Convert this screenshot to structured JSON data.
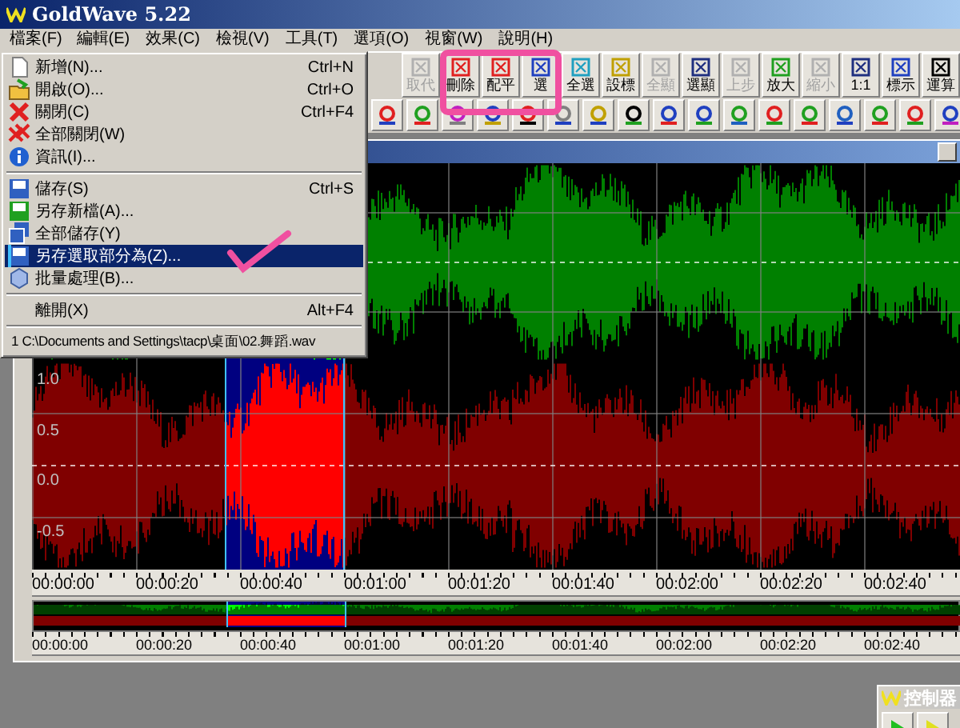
{
  "window": {
    "title": "GoldWave 5.22"
  },
  "menu_bar": [
    {
      "label": "檔案(F)",
      "selected": true
    },
    {
      "label": "編輯(E)",
      "selected": false
    },
    {
      "label": "效果(C)",
      "selected": false
    },
    {
      "label": "檢視(V)",
      "selected": false
    },
    {
      "label": "工具(T)",
      "selected": false
    },
    {
      "label": "選項(O)",
      "selected": false
    },
    {
      "label": "視窗(W)",
      "selected": false
    },
    {
      "label": "說明(H)",
      "selected": false
    }
  ],
  "file_menu": [
    {
      "kind": "command",
      "label": "新增(N)...",
      "shortcut": "Ctrl+N",
      "selected": false
    },
    {
      "kind": "command",
      "label": "開啟(O)...",
      "shortcut": "Ctrl+O",
      "selected": false
    },
    {
      "kind": "command",
      "label": "關閉(C)",
      "shortcut": "Ctrl+F4",
      "selected": false
    },
    {
      "kind": "command",
      "label": "全部關閉(W)",
      "selected": false
    },
    {
      "kind": "command",
      "label": "資訊(I)...",
      "selected": false
    },
    {
      "kind": "separator"
    },
    {
      "kind": "command",
      "label": "儲存(S)",
      "shortcut": "Ctrl+S",
      "selected": false
    },
    {
      "kind": "command",
      "label": "另存新檔(A)...",
      "selected": false
    },
    {
      "kind": "command",
      "label": "全部儲存(Y)",
      "selected": false
    },
    {
      "kind": "command",
      "label": "另存選取部分為(Z)...",
      "selected": true
    },
    {
      "kind": "command",
      "label": "批量處理(B)...",
      "selected": false
    },
    {
      "kind": "separator"
    },
    {
      "kind": "command",
      "label": "離開(X)",
      "shortcut": "Alt+F4",
      "selected": false
    },
    {
      "kind": "separator"
    },
    {
      "kind": "recent",
      "label": "1 C:\\Documents and Settings\\tacp\\桌面\\02.舞蹈.wav",
      "selected": false
    }
  ],
  "toolbar": [
    {
      "label": "取代",
      "disabled": true
    },
    {
      "label": "刪除",
      "disabled": false
    },
    {
      "label": "配平",
      "disabled": false
    },
    {
      "label": "選",
      "disabled": false
    },
    {
      "label": "全選",
      "disabled": false
    },
    {
      "label": "設標",
      "disabled": false
    },
    {
      "label": "全顯",
      "disabled": true
    },
    {
      "label": "選顯",
      "disabled": false
    },
    {
      "label": "上步",
      "disabled": true
    },
    {
      "label": "放大",
      "disabled": false
    },
    {
      "label": "縮小",
      "disabled": true
    },
    {
      "label": "1:1",
      "disabled": false
    },
    {
      "label": "標示",
      "disabled": false
    },
    {
      "label": "運算",
      "disabled": false
    }
  ],
  "document": {
    "amplitude_labels": [
      "1.0",
      "0.5",
      "0.0",
      "-0.5"
    ],
    "time_labels": [
      "00:00:00",
      "00:00:20",
      "00:00:40",
      "00:01:00",
      "00:01:20",
      "00:01:40",
      "00:02:00",
      "00:02:20",
      "00:02:40"
    ],
    "overview_time_labels": [
      "00:00:00",
      "00:00:20",
      "00:00:40",
      "00:01:00",
      "00:01:20",
      "00:01:40",
      "00:02:00",
      "00:02:20",
      "00:02:40"
    ]
  },
  "control_window": {
    "title": "控制器"
  }
}
